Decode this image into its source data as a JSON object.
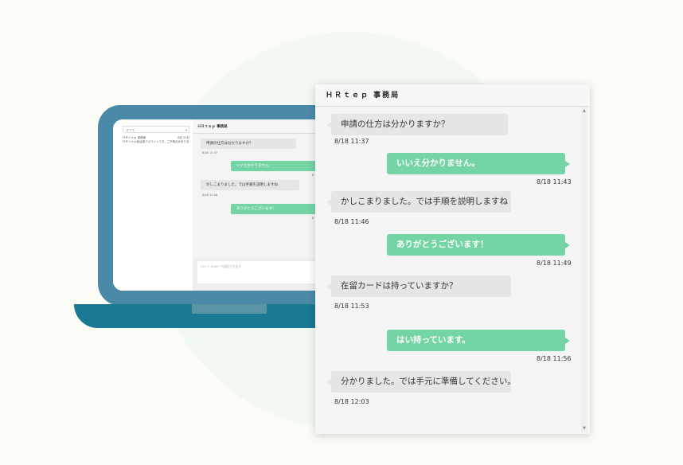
{
  "colors": {
    "incoming_bubble": "#e6e6e6",
    "outgoing_bubble": "#74d4a4",
    "laptop_lid": "#4a8aa8",
    "laptop_base": "#1a7a93"
  },
  "laptop": {
    "filter_select": "すべて",
    "room_name": "ＨＲｔｅｐ 事務局",
    "room_date": "8月 23日",
    "room_preview": "ＨＲｔｅｐ就活用アカウントです。ご不明点がありましたら…",
    "chat_title": "ＨＲｔｅｐ 事務局",
    "messages": [
      {
        "text": "申請の仕方は分かりますか？",
        "time": "8/18 11:37"
      },
      {
        "text": "いいえ分かりません。",
        "time": "8"
      },
      {
        "text": "かしこまりました。では手順を説明しますね",
        "time": "8/18 11:46"
      },
      {
        "text": "ありがとうございます！",
        "time": "8"
      }
    ],
    "input_placeholder": "Ctrl ＋ Enter で送信できます"
  },
  "panel": {
    "title": "ＨＲｔｅｐ 事務局",
    "messages": [
      {
        "direction": "in",
        "text": "申請の仕方は分かりますか？",
        "time": "8/18 11:37"
      },
      {
        "direction": "out",
        "text": "いいえ分かりません。",
        "time": "8/18 11:43"
      },
      {
        "direction": "in",
        "text": "かしこまりました。では手順を説明しますね",
        "time": "8/18 11:46"
      },
      {
        "direction": "out",
        "text": "ありがとうございます！",
        "time": "8/18 11:49"
      },
      {
        "direction": "in",
        "text": "在留カードは持っていますか？",
        "time": "8/18 11:53"
      },
      {
        "direction": "out",
        "text": "はい持っています。",
        "time": "8/18 11:56"
      },
      {
        "direction": "in",
        "text": "分かりました。では手元に準備してください。",
        "time": "8/18 12:03"
      }
    ]
  }
}
